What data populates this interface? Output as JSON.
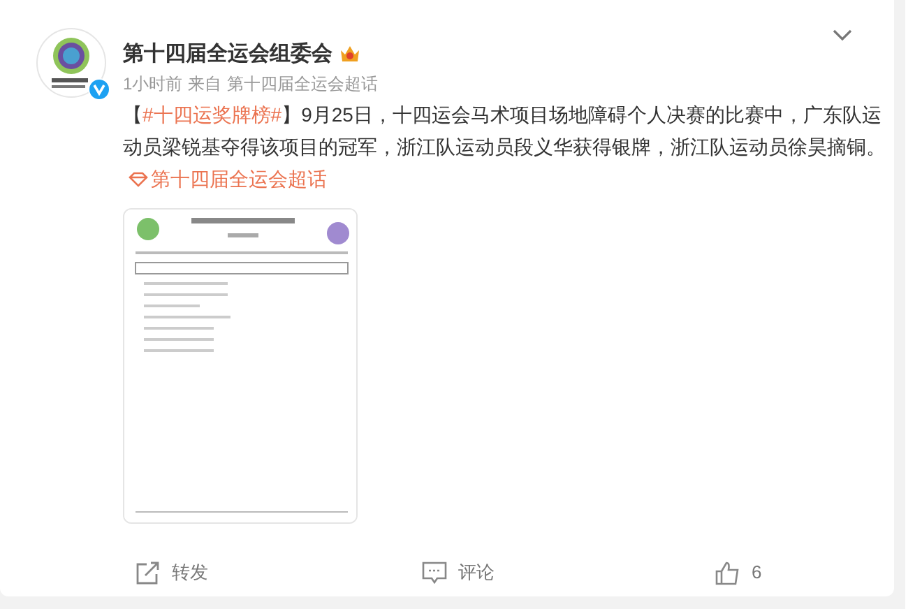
{
  "post": {
    "author": "第十四届全运会组委会",
    "verified": true,
    "time": "1小时前",
    "source_prefix": "来自",
    "source": "第十四届全运会超话",
    "content": [
      {
        "kind": "text",
        "text": "【"
      },
      {
        "kind": "topic",
        "text": "#十四运奖牌榜#"
      },
      {
        "kind": "text",
        "text": "】9月25日，十四运会马术项目场地障碍个人决赛的比赛中，广东队运动员梁锐基夺得该项目的冠军，浙江队运动员段义华获得银牌，浙江队运动员徐昊摘铜。"
      },
      {
        "kind": "supertopic",
        "text": "第十四届全运会超话"
      }
    ],
    "actions": [
      {
        "kind": "share",
        "label": "转发"
      },
      {
        "kind": "comment",
        "label": "评论"
      },
      {
        "kind": "like",
        "label": "6"
      }
    ]
  }
}
